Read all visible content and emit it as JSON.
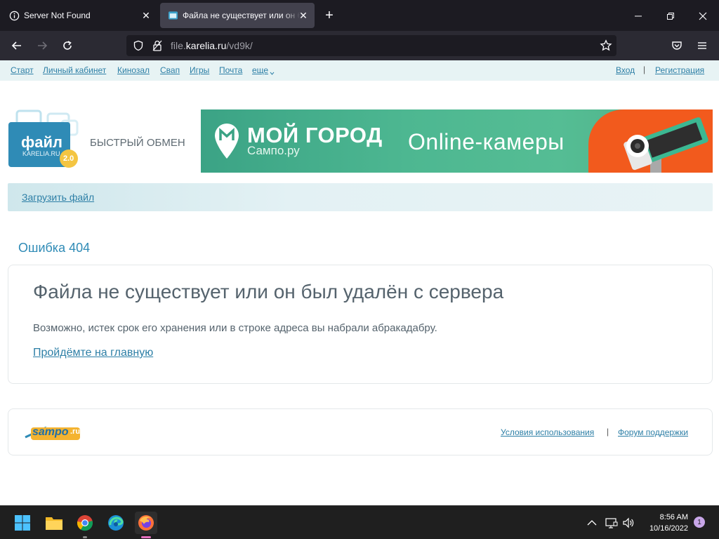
{
  "browser": {
    "tabs": [
      {
        "title": "Server Not Found",
        "icon": "info-icon",
        "active": false
      },
      {
        "title": "Файла не существует или он был удалён с сервера",
        "icon": "page-icon",
        "active": true
      }
    ],
    "url_prefix": "file.",
    "url_host": "karelia.ru",
    "url_path": "/vd9k/",
    "colors": {
      "tabbar": "#1c1b22",
      "navbar": "#2b2a33",
      "active_tab": "#42414d"
    }
  },
  "sitenav": {
    "left": [
      "Старт",
      "Личный кабинет",
      "Кинозал",
      "Свап",
      "Игры",
      "Почта",
      "еще"
    ],
    "login": "Вход",
    "separator": "|",
    "register": "Регистрация"
  },
  "header": {
    "logo_word": "файл",
    "logo_domain": "KARELIA.RU",
    "logo_version": "2.0",
    "slogan": "БЫСТРЫЙ ОБМЕН",
    "banner": {
      "brand": "МОЙ ГОРОД",
      "brand_sub": "Сампо.ру",
      "headline": "Online-камеры"
    }
  },
  "upload_label": "Загрузить файл",
  "error": {
    "code": "Ошибка 404",
    "title": "Файла не существует или он был удалён с сервера",
    "text": "Возможно, истек срок его хранения или в строке адреса вы набрали абракадабру.",
    "link": "Пройдёмте на главную"
  },
  "footer": {
    "logo_text": "sampo",
    "logo_suffix": ".ru",
    "terms": "Условия использования",
    "separator": "|",
    "support": "Форум поддержки"
  },
  "taskbar": {
    "time": "8:56 AM",
    "date": "10/16/2022",
    "notifications": "1",
    "accent": "#e56fbd"
  }
}
